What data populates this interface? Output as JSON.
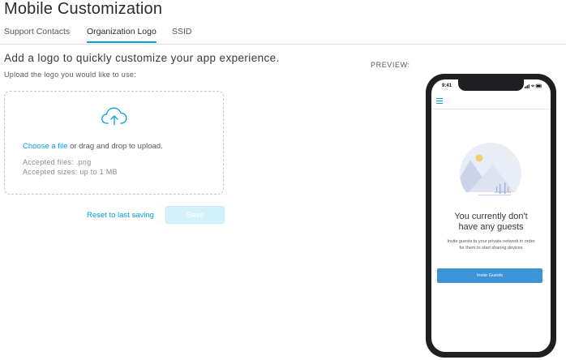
{
  "page": {
    "title": "Mobile Customization"
  },
  "tabs": [
    {
      "label": "Support Contacts",
      "active": false
    },
    {
      "label": "Organization Logo",
      "active": true
    },
    {
      "label": "SSID",
      "active": false
    }
  ],
  "content": {
    "headline": "Add a logo to quickly customize your app experience.",
    "subline": "Upload the logo you would like to use:"
  },
  "upload": {
    "icon": "cloud-upload-icon",
    "choose_link": "Choose a file",
    "choose_rest": " or drag and drop to upload.",
    "accepted_files": "Accepted files: .png",
    "accepted_sizes": "Accepted sizes: up to 1 MB"
  },
  "actions": {
    "reset_label": "Reset to last saving",
    "save_label": "Save"
  },
  "preview": {
    "label": "PREVIEW:",
    "status_time": "9:41",
    "empty_title_line1": "You currently don't",
    "empty_title_line2": "have any guests",
    "empty_desc_line1": "Invite guests to your private network in order",
    "empty_desc_line2": "for them to start sharing devices",
    "invite_label": "Invite Guests"
  },
  "colors": {
    "accent": "#049fd9",
    "save_disabled": "#d3f1fb",
    "invite_button": "#3d93d5",
    "phone_frame": "#1f1f21"
  }
}
